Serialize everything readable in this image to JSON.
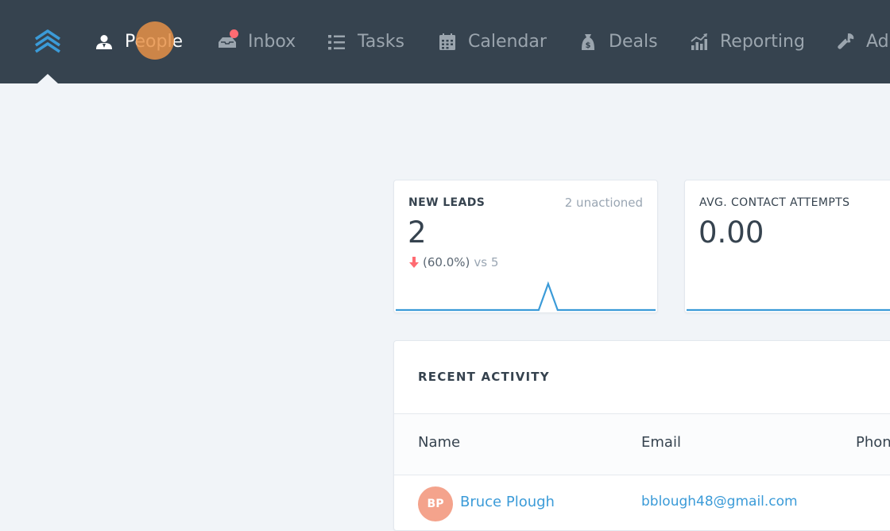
{
  "nav": {
    "logo_icon": "layers-chevron-icon",
    "items": [
      {
        "label": "People",
        "icon": "person-icon",
        "active": true
      },
      {
        "label": "Inbox",
        "icon": "inbox-tray-icon",
        "notification": true
      },
      {
        "label": "Tasks",
        "icon": "list-icon"
      },
      {
        "label": "Calendar",
        "icon": "calendar-icon"
      },
      {
        "label": "Deals",
        "icon": "money-bag-icon"
      },
      {
        "label": "Reporting",
        "icon": "bar-chart-icon"
      },
      {
        "label": "Ad",
        "icon": "wrench-icon"
      }
    ]
  },
  "metrics": {
    "new_leads": {
      "label": "NEW LEADS",
      "side_text": "2 unactioned",
      "value": "2",
      "change": "(60.0%)",
      "compare": "vs 5",
      "trend": "down"
    },
    "avg_contact": {
      "label": "AVG. CONTACT ATTEMPTS",
      "value": "0.00"
    }
  },
  "recent_activity": {
    "title": "RECENT ACTIVITY",
    "columns": [
      "Name",
      "Email",
      "Phon"
    ],
    "rows": [
      {
        "initials": "BP",
        "name": "Bruce Plough",
        "email": "bblough48@gmail.com"
      }
    ]
  },
  "colors": {
    "nav_bg": "#36434f",
    "accent": "#3b9bd8",
    "alert": "#ff6b72",
    "page_bg": "#f1f4f8"
  }
}
